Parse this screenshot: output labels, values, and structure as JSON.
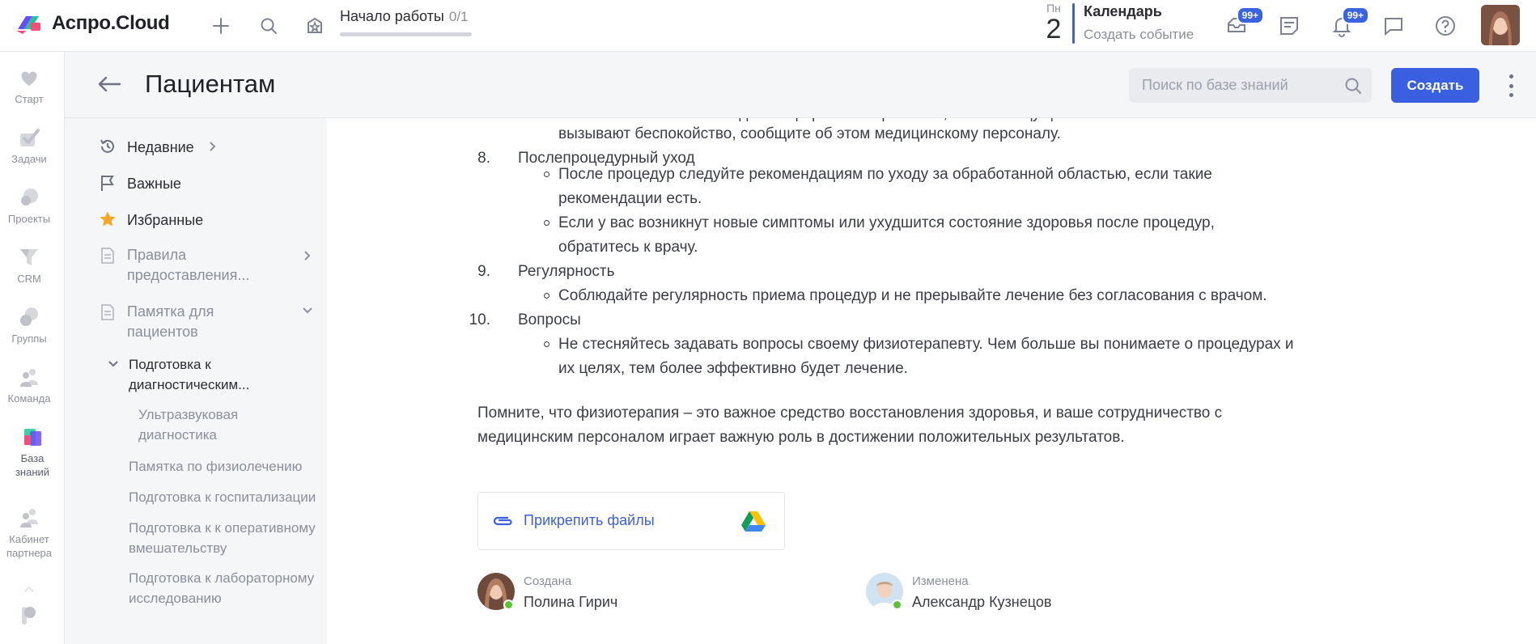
{
  "topbar": {
    "brand": "Аспро.Cloud",
    "start_work": {
      "label": "Начало работы",
      "count": "0/1",
      "progress": 0
    },
    "calendar": {
      "weekday": "Пн",
      "day": "2",
      "title": "Календарь",
      "action": "Создать событие"
    },
    "mail_badge": "99+",
    "notif_badge": "99+"
  },
  "rail": {
    "items": [
      {
        "label": "Старт",
        "icon": "heart-icon"
      },
      {
        "label": "Задачи",
        "icon": "check-icon"
      },
      {
        "label": "Проекты",
        "icon": "projects-icon"
      },
      {
        "label": "CRM",
        "icon": "funnel-icon"
      },
      {
        "label": "Группы",
        "icon": "groups-icon"
      },
      {
        "label": "Команда",
        "icon": "team-icon"
      },
      {
        "label": "База знаний",
        "icon": "knowledge-base-icon"
      },
      {
        "label": "Кабинет партнера",
        "icon": "partner-icon"
      }
    ]
  },
  "header": {
    "title": "Пациентам",
    "search_placeholder": "Поиск по базе знаний",
    "create_label": "Создать"
  },
  "tree": {
    "recent": "Недавние",
    "important": "Важные",
    "favorites": "Избранные",
    "rules": "Правила предоставления...",
    "memo": "Памятка для пациентов",
    "diag": "Подготовка к диагностическим...",
    "ultra": "Ультразвуковая диагностика",
    "physio": "Памятка по физиолечению",
    "hosp": "Подготовка к госпитализации",
    "oper": "Подготовка к к оперативному вмешательству",
    "lab": "Подготовка к лабораторному исследованию"
  },
  "content": {
    "top_cut": "покалывание или легкое дискомфорт. Это нормально, но если ощущения становятся сильными или",
    "top_line2": "вызывают беспокойство, сообщите об этом медицинскому персоналу.",
    "item8": {
      "num": "8.",
      "title": "Послепроцедурный уход",
      "b1_l1": "После процедур следуйте рекомендациям по уходу за обработанной областью, если такие",
      "b1_l2": "рекомендации есть.",
      "b2_l1": "Если у вас возникнут новые симптомы или ухудшится состояние здоровья после процедур,",
      "b2_l2": "обратитесь к врачу."
    },
    "item9": {
      "num": "9.",
      "title": "Регулярность",
      "b1_l1": "Соблюдайте регулярность приема процедур и не прерывайте лечение без согласования с врачом."
    },
    "item10": {
      "num": "10.",
      "title": "Вопросы",
      "b1_l1": "Не стесняйтесь задавать вопросы своему физиотерапевту. Чем больше вы понимаете о процедурах и",
      "b1_l2": "их целях, тем более эффективно будет лечение."
    },
    "closing_l1": "Помните, что физиотерапия – это важное средство восстановления здоровья, и ваше сотрудничество с",
    "closing_l2": "медицинским персоналом играет важную роль в достижении положительных результатов.",
    "attach_label": "Прикрепить файлы",
    "created_label": "Создана",
    "created_by": "Полина Гирич",
    "modified_label": "Изменена",
    "modified_by": "Александр Кузнецов"
  },
  "colors": {
    "accent": "#3a5fe0",
    "online": "#5cc23a",
    "star": "#f5a623"
  }
}
